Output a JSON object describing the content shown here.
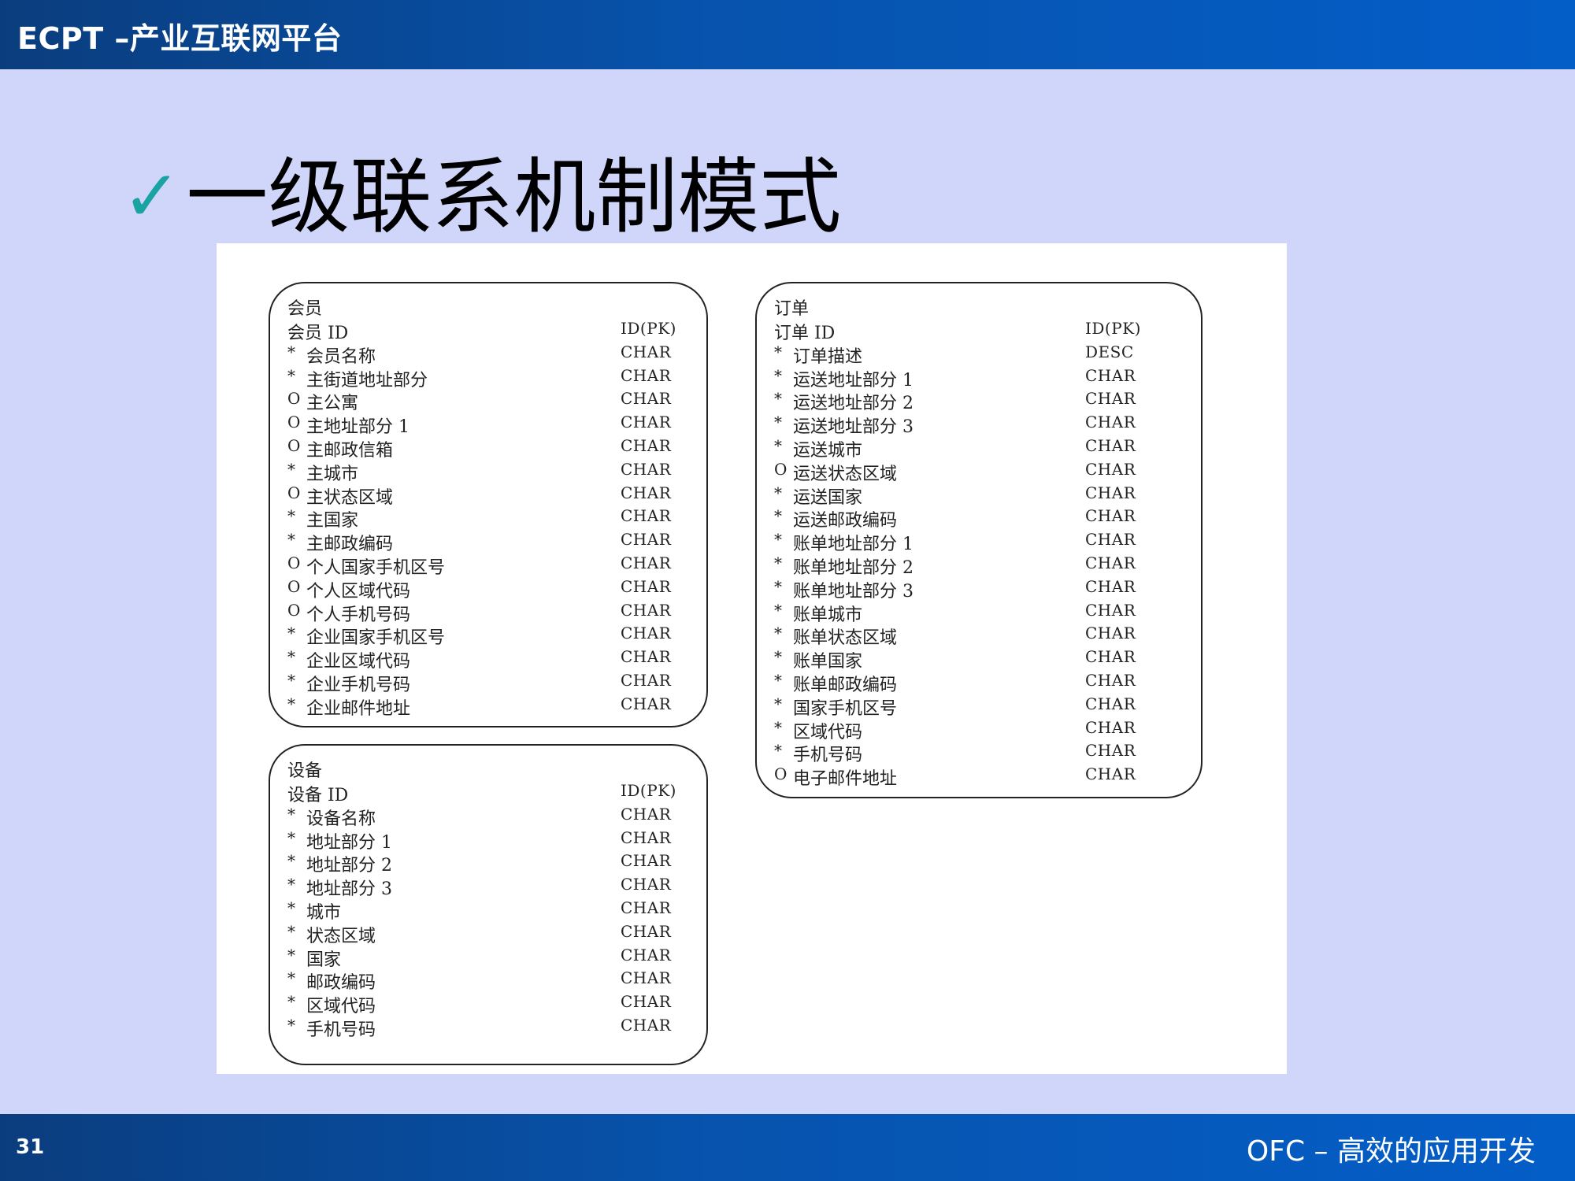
{
  "header": {
    "title": "ECPT –产业互联网平台"
  },
  "slide": {
    "check_glyph": "✓",
    "heading": "一级联系机制模式"
  },
  "footer": {
    "page_number": "31",
    "text": "OFC – 高效的应用开发"
  },
  "entities": [
    {
      "name": "会员",
      "fields": [
        {
          "mark": "",
          "name": "会员 ID",
          "type": "ID(PK)"
        },
        {
          "mark": "*",
          "name": "会员名称",
          "type": "CHAR"
        },
        {
          "mark": "*",
          "name": "主街道地址部分",
          "type": "CHAR"
        },
        {
          "mark": "O",
          "name": "主公寓",
          "type": "CHAR"
        },
        {
          "mark": "O",
          "name": "主地址部分 1",
          "type": "CHAR"
        },
        {
          "mark": "O",
          "name": "主邮政信箱",
          "type": "CHAR"
        },
        {
          "mark": "*",
          "name": "主城市",
          "type": "CHAR"
        },
        {
          "mark": "O",
          "name": "主状态区域",
          "type": "CHAR"
        },
        {
          "mark": "*",
          "name": "主国家",
          "type": "CHAR"
        },
        {
          "mark": "*",
          "name": "主邮政编码",
          "type": "CHAR"
        },
        {
          "mark": "O",
          "name": "个人国家手机区号",
          "type": "CHAR"
        },
        {
          "mark": "O",
          "name": "个人区域代码",
          "type": "CHAR"
        },
        {
          "mark": "O",
          "name": "个人手机号码",
          "type": "CHAR"
        },
        {
          "mark": "*",
          "name": "企业国家手机区号",
          "type": "CHAR"
        },
        {
          "mark": "*",
          "name": "企业区域代码",
          "type": "CHAR"
        },
        {
          "mark": "*",
          "name": "企业手机号码",
          "type": "CHAR"
        },
        {
          "mark": "*",
          "name": "企业邮件地址",
          "type": "CHAR"
        }
      ]
    },
    {
      "name": "设备",
      "fields": [
        {
          "mark": "",
          "name": "设备 ID",
          "type": "ID(PK)"
        },
        {
          "mark": "*",
          "name": "设备名称",
          "type": "CHAR"
        },
        {
          "mark": "*",
          "name": "地址部分 1",
          "type": "CHAR"
        },
        {
          "mark": "*",
          "name": "地址部分 2",
          "type": "CHAR"
        },
        {
          "mark": "*",
          "name": "地址部分 3",
          "type": "CHAR"
        },
        {
          "mark": "*",
          "name": "城市",
          "type": "CHAR"
        },
        {
          "mark": "*",
          "name": "状态区域",
          "type": "CHAR"
        },
        {
          "mark": "*",
          "name": "国家",
          "type": "CHAR"
        },
        {
          "mark": "*",
          "name": "邮政编码",
          "type": "CHAR"
        },
        {
          "mark": "*",
          "name": "区域代码",
          "type": "CHAR"
        },
        {
          "mark": "*",
          "name": "手机号码",
          "type": "CHAR"
        }
      ]
    },
    {
      "name": "订单",
      "fields": [
        {
          "mark": "",
          "name": "订单 ID",
          "type": "ID(PK)"
        },
        {
          "mark": "*",
          "name": "订单描述",
          "type": "DESC"
        },
        {
          "mark": "*",
          "name": "运送地址部分 1",
          "type": "CHAR"
        },
        {
          "mark": "*",
          "name": "运送地址部分 2",
          "type": "CHAR"
        },
        {
          "mark": "*",
          "name": "运送地址部分 3",
          "type": "CHAR"
        },
        {
          "mark": "*",
          "name": "运送城市",
          "type": "CHAR"
        },
        {
          "mark": "O",
          "name": "运送状态区域",
          "type": "CHAR"
        },
        {
          "mark": "*",
          "name": "运送国家",
          "type": "CHAR"
        },
        {
          "mark": "*",
          "name": "运送邮政编码",
          "type": "CHAR"
        },
        {
          "mark": "*",
          "name": "账单地址部分 1",
          "type": "CHAR"
        },
        {
          "mark": "*",
          "name": "账单地址部分 2",
          "type": "CHAR"
        },
        {
          "mark": "*",
          "name": "账单地址部分 3",
          "type": "CHAR"
        },
        {
          "mark": "*",
          "name": "账单城市",
          "type": "CHAR"
        },
        {
          "mark": "*",
          "name": "账单状态区域",
          "type": "CHAR"
        },
        {
          "mark": "*",
          "name": "账单国家",
          "type": "CHAR"
        },
        {
          "mark": "*",
          "name": "账单邮政编码",
          "type": "CHAR"
        },
        {
          "mark": "*",
          "name": "国家手机区号",
          "type": "CHAR"
        },
        {
          "mark": "*",
          "name": "区域代码",
          "type": "CHAR"
        },
        {
          "mark": "*",
          "name": "手机号码",
          "type": "CHAR"
        },
        {
          "mark": "O",
          "name": "电子邮件地址",
          "type": "CHAR"
        }
      ]
    }
  ]
}
